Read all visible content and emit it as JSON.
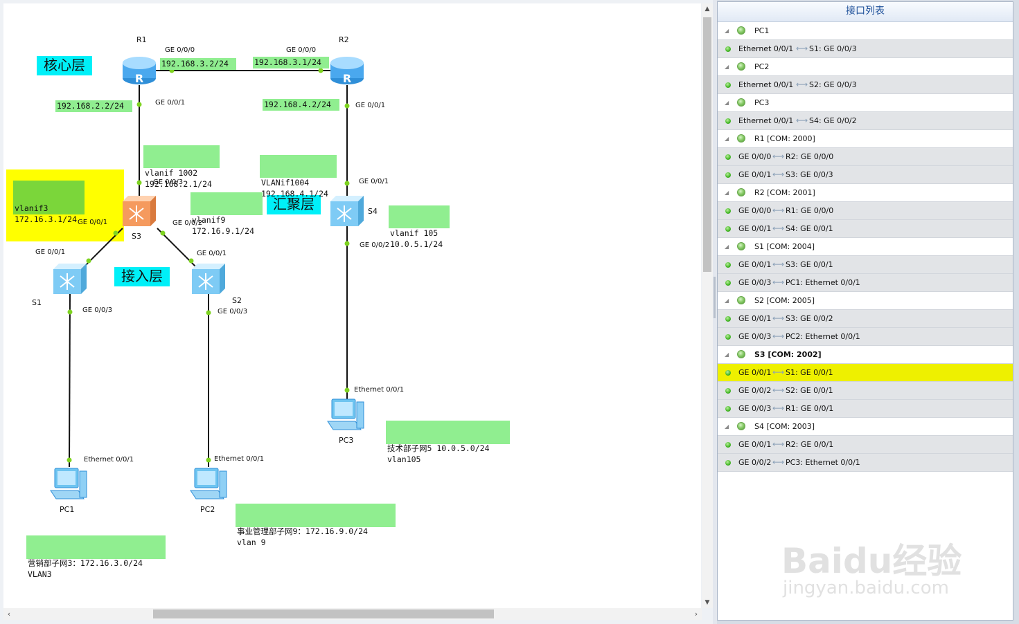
{
  "panel": {
    "title": "接口列表",
    "rows": [
      {
        "type": "device",
        "name": "PC1"
      },
      {
        "type": "iface",
        "a": "Ethernet 0/0/1",
        "b": "S1: GE 0/0/3"
      },
      {
        "type": "device",
        "name": "PC2"
      },
      {
        "type": "iface",
        "a": "Ethernet 0/0/1",
        "b": "S2: GE 0/0/3"
      },
      {
        "type": "device",
        "name": "PC3"
      },
      {
        "type": "iface",
        "a": "Ethernet 0/0/1",
        "b": "S4: GE 0/0/2"
      },
      {
        "type": "device",
        "name": "R1 [COM: 2000]"
      },
      {
        "type": "iface",
        "a": "GE 0/0/0",
        "b": "R2: GE 0/0/0"
      },
      {
        "type": "iface",
        "a": "GE 0/0/1",
        "b": "S3: GE 0/0/3"
      },
      {
        "type": "device",
        "name": "R2 [COM: 2001]"
      },
      {
        "type": "iface",
        "a": "GE 0/0/0",
        "b": "R1: GE 0/0/0"
      },
      {
        "type": "iface",
        "a": "GE 0/0/1",
        "b": "S4: GE 0/0/1"
      },
      {
        "type": "device",
        "name": "S1 [COM: 2004]"
      },
      {
        "type": "iface",
        "a": "GE 0/0/1",
        "b": "S3: GE 0/0/1"
      },
      {
        "type": "iface",
        "a": "GE 0/0/3",
        "b": "PC1: Ethernet 0/0/1"
      },
      {
        "type": "device",
        "name": "S2 [COM: 2005]"
      },
      {
        "type": "iface",
        "a": "GE 0/0/1",
        "b": "S3: GE 0/0/2"
      },
      {
        "type": "iface",
        "a": "GE 0/0/3",
        "b": "PC2: Ethernet 0/0/1"
      },
      {
        "type": "device",
        "name": "S3 [COM: 2002]",
        "bold": true
      },
      {
        "type": "iface",
        "a": "GE 0/0/1",
        "b": "S1: GE 0/0/1",
        "selected": true
      },
      {
        "type": "iface",
        "a": "GE 0/0/2",
        "b": "S2: GE 0/0/1"
      },
      {
        "type": "iface",
        "a": "GE 0/0/3",
        "b": "R1: GE 0/0/1"
      },
      {
        "type": "device",
        "name": "S4 [COM: 2003]"
      },
      {
        "type": "iface",
        "a": "GE 0/0/1",
        "b": "R2: GE 0/0/1"
      },
      {
        "type": "iface",
        "a": "GE 0/0/2",
        "b": "PC3: Ethernet 0/0/1"
      }
    ]
  },
  "topology": {
    "devices": {
      "R1": "R1",
      "R2": "R2",
      "S1": "S1",
      "S2": "S2",
      "S3": "S3",
      "S4": "S4",
      "PC1": "PC1",
      "PC2": "PC2",
      "PC3": "PC3"
    },
    "ports": {
      "r1_g0": "GE 0/0/0",
      "r2_g0": "GE 0/0/0",
      "r1_g1": "GE 0/0/1",
      "r2_g1": "GE 0/0/1",
      "s3_g3": "GE 0/0/3",
      "s3_g1": "GE 0/0/1",
      "s3_g2": "GE 0/0/2",
      "s4_g1": "GE 0/0/1",
      "s4_g2": "GE 0/0/2",
      "s1_g1": "GE 0/0/1",
      "s1_g3": "GE 0/0/3",
      "s2_g1": "GE 0/0/1",
      "s2_g3": "GE 0/0/3",
      "pc1_e": "Ethernet 0/0/1",
      "pc2_e": "Ethernet 0/0/1",
      "pc3_e": "Ethernet 0/0/1"
    },
    "layers": {
      "core": "核心层",
      "agg": "汇聚层",
      "access": "接入层"
    },
    "ip_boxes": {
      "r1_g0_ip": "192.168.3.2/24",
      "r2_g0_ip": "192.168.3.1/24",
      "r1_g1_ip": "192.168.2.2/24",
      "r2_g1_ip": "192.168.4.2/24",
      "vlanif1002": [
        "vlanif 1002",
        "192.168.2.1/24"
      ],
      "vlanif1004": [
        "VLANif1004",
        "192.168.4.1/24"
      ],
      "vlanif3": [
        "vlanif3",
        "172.16.3.1/24"
      ],
      "vlanif9": [
        "vlanif9",
        "172.16.9.1/24"
      ],
      "vlanif105": [
        "vlanif 105",
        "10.0.5.1/24"
      ],
      "net_pc3": [
        "技术部子网5 10.0.5.0/24",
        "vlan105"
      ],
      "net_pc2": [
        "事业管理部子网9：172.16.9.0/24",
        "vlan 9"
      ],
      "net_pc1": [
        "营销部子网3：172.16.3.0/24",
        "VLAN3"
      ]
    }
  },
  "watermark": {
    "logo": "Baidu经验",
    "url": "jingyan.baidu.com"
  },
  "colors": {
    "label_green": "#90ee90",
    "layer_cyan": "#00f0f8",
    "highlight": "#ffff00",
    "link_dot": "#7ed321"
  }
}
